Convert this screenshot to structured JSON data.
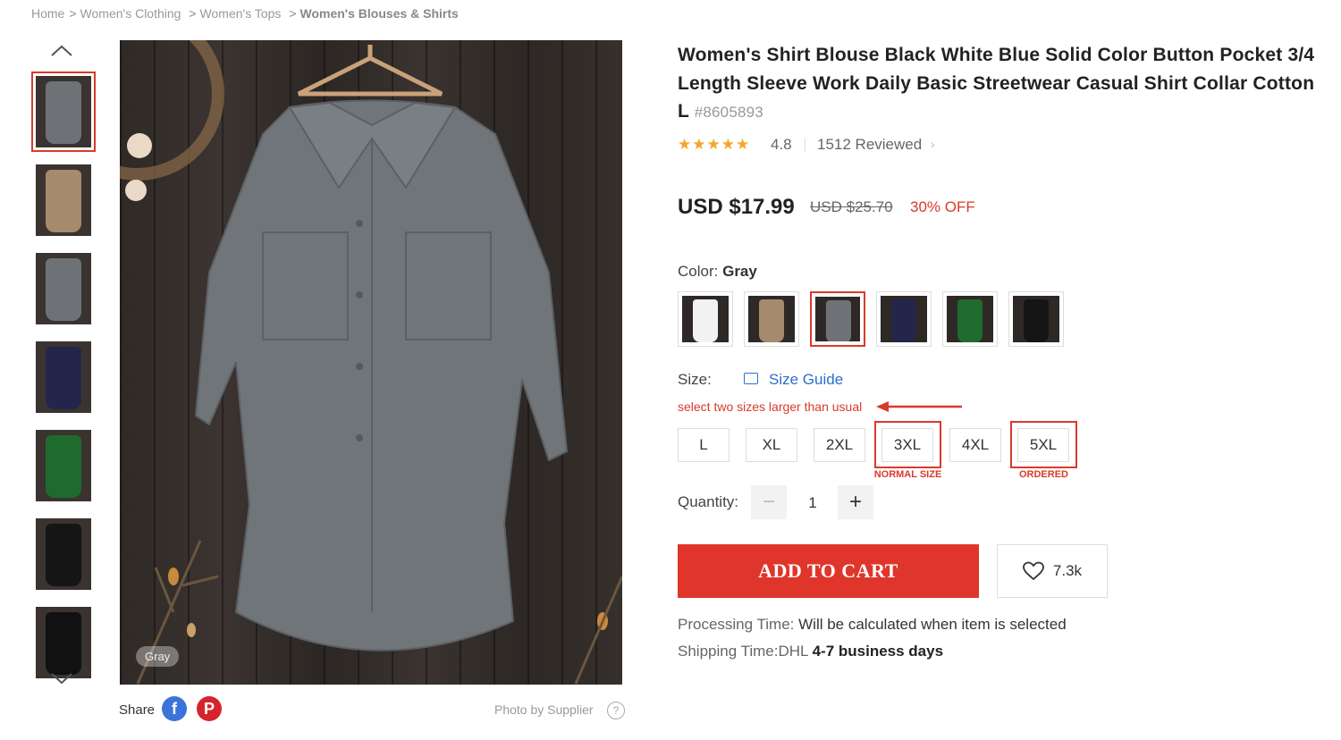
{
  "breadcrumb": {
    "items": [
      "Home",
      "Women's Clothing",
      "Women's Tops",
      "Women's Blouses & Shirts"
    ],
    "separator": ">"
  },
  "gallery": {
    "thumbnail_colors": [
      "#6e7276",
      "#a58a6d",
      "#6e7276",
      "#23264a",
      "#1f6b2d",
      "#151515",
      "#111111"
    ],
    "selected_index": 0,
    "tag": "Gray",
    "share_label": "Share",
    "photo_by": "Photo by Supplier",
    "help": "?"
  },
  "product": {
    "title": "Women's Shirt Blouse Black White Blue Solid Color Button Pocket 3/4 Length Sleeve Work Daily Basic Streetwear Casual Shirt Collar Cotton L",
    "sku": "#8605893",
    "rating": "4.8",
    "stars": "★★★★★",
    "reviews": "1512 Reviewed",
    "reviews_arrow": "›",
    "price": "USD $17.99",
    "old_price": "USD $25.70",
    "discount": "30% OFF"
  },
  "color": {
    "label": "Color:",
    "value": "Gray",
    "options": [
      {
        "name": "White",
        "hex": "#f2f2f2"
      },
      {
        "name": "Khaki",
        "hex": "#a58a6d"
      },
      {
        "name": "Gray",
        "hex": "#6e7276"
      },
      {
        "name": "Navy",
        "hex": "#23264a"
      },
      {
        "name": "Green",
        "hex": "#1f6b2d"
      },
      {
        "name": "Black",
        "hex": "#151515"
      }
    ],
    "selected_index": 2
  },
  "size": {
    "label": "Size:",
    "guide": "Size Guide",
    "note": "select two sizes larger than usual",
    "options": [
      "L",
      "XL",
      "2XL",
      "3XL",
      "4XL",
      "5XL"
    ],
    "annotations": {
      "normal": "NORMAL SIZE",
      "ordered": "ORDERED"
    }
  },
  "quantity": {
    "label": "Quantity:",
    "value": "1",
    "minus": "−",
    "plus": "+"
  },
  "actions": {
    "add_to_cart": "ADD TO CART",
    "wishlist_count": "7.3k"
  },
  "shipping": {
    "processing_label": "Processing Time:",
    "processing_value": "Will be calculated when item is selected",
    "shipping_label": "Shipping Time:",
    "carrier": "DHL",
    "days": "4-7 business days"
  },
  "colors": {
    "accent": "#d93a2b",
    "cart": "#e0352b",
    "link": "#2a6fce",
    "star": "#f5a623"
  }
}
